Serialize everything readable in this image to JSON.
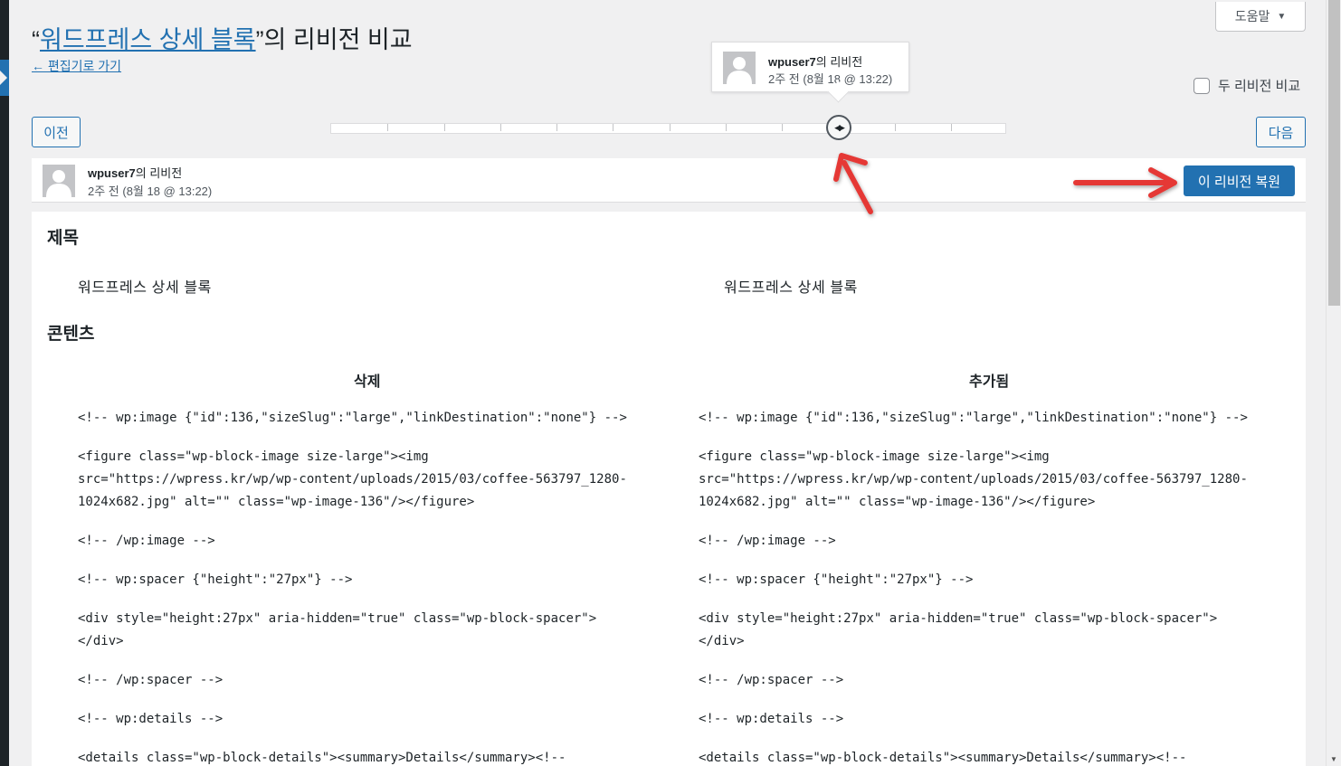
{
  "colors": {
    "accent": "#2271b1",
    "annotation_arrow": "#e53935"
  },
  "help": {
    "label": "도움말",
    "icon": "caret-down-icon"
  },
  "header": {
    "title_open_quote": "“",
    "title_link": "워드프레스 상세 블록",
    "title_suffix": "”의 리비전 비교",
    "back_link": "← 편집기로 가기"
  },
  "tooltip": {
    "author": "wpuser7",
    "author_suffix": "의 리비전",
    "time": "2주 전 (8월 18 @ 13:22)"
  },
  "compare": {
    "label": "두 리비전 비교"
  },
  "nav": {
    "prev": "이전",
    "next": "다음"
  },
  "revision_meta": {
    "author": "wpuser7",
    "author_suffix": "의 리비전",
    "time": "2주 전 (8월 18 @ 13:22)",
    "restore_button": "이 리비전 복원"
  },
  "diff": {
    "title_heading": "제목",
    "title_old": "워드프레스 상세 블록",
    "title_new": "워드프레스 상세 블록",
    "content_heading": "콘텐츠",
    "removed_label": "삭제",
    "added_label": "추가됨",
    "left_lines": [
      "<!-- wp:image {\"id\":136,\"sizeSlug\":\"large\",\"linkDestination\":\"none\"} -->",
      "",
      "<figure class=\"wp-block-image size-large\"><img",
      "src=\"https://wpress.kr/wp/wp-content/uploads/2015/03/coffee-563797_1280-",
      "1024x682.jpg\" alt=\"\" class=\"wp-image-136\"/></figure>",
      "",
      "<!-- /wp:image -->",
      "",
      "<!-- wp:spacer {\"height\":\"27px\"} -->",
      "",
      "<div style=\"height:27px\" aria-hidden=\"true\" class=\"wp-block-spacer\">",
      "</div>",
      "",
      "<!-- /wp:spacer -->",
      "",
      "<!-- wp:details -->",
      "",
      "<details class=\"wp-block-details\"><summary>Details</summary><!--"
    ],
    "right_lines": [
      "<!-- wp:image {\"id\":136,\"sizeSlug\":\"large\",\"linkDestination\":\"none\"} -->",
      "",
      "<figure class=\"wp-block-image size-large\"><img",
      "src=\"https://wpress.kr/wp/wp-content/uploads/2015/03/coffee-563797_1280-",
      "1024x682.jpg\" alt=\"\" class=\"wp-image-136\"/></figure>",
      "",
      "<!-- /wp:image -->",
      "",
      "<!-- wp:spacer {\"height\":\"27px\"} -->",
      "",
      "<div style=\"height:27px\" aria-hidden=\"true\" class=\"wp-block-spacer\">",
      "</div>",
      "",
      "<!-- /wp:spacer -->",
      "",
      "<!-- wp:details -->",
      "",
      "<details class=\"wp-block-details\"><summary>Details</summary><!--"
    ]
  }
}
